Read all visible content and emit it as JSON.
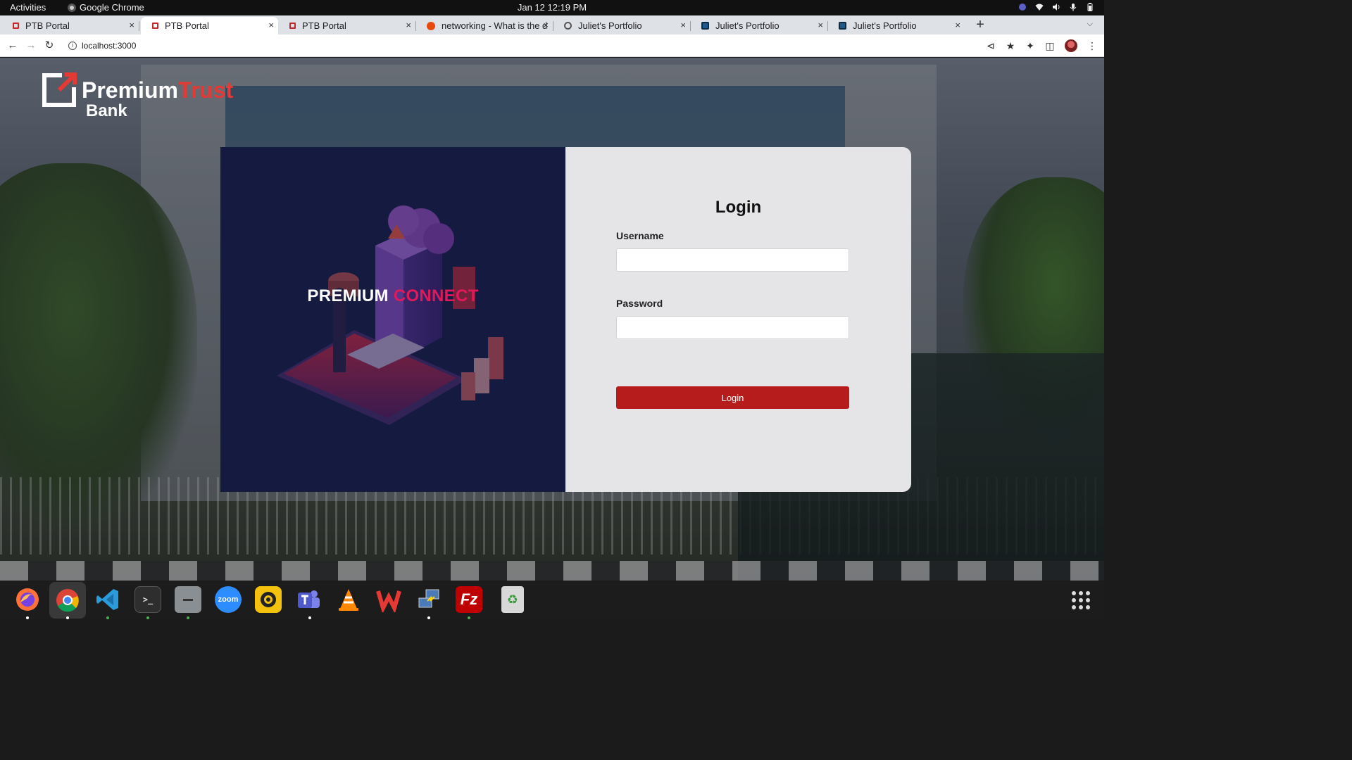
{
  "system_bar": {
    "activities": "Activities",
    "app_name": "Google Chrome",
    "datetime": "Jan 12  12:19 PM"
  },
  "tabs": [
    {
      "title": "PTB Portal",
      "favicon": "ptb-icon",
      "active": false
    },
    {
      "title": "PTB Portal",
      "favicon": "ptb-icon",
      "active": true
    },
    {
      "title": "PTB Portal",
      "favicon": "ptb-icon",
      "active": false
    },
    {
      "title": "networking - What is the d",
      "favicon": "askubuntu-icon",
      "active": false
    },
    {
      "title": "Juliet's Portfolio",
      "favicon": "globe-icon",
      "active": false
    },
    {
      "title": "Juliet's Portfolio",
      "favicon": "portfolio-icon",
      "active": false
    },
    {
      "title": "Juliet's Portfolio",
      "favicon": "portfolio-icon",
      "active": false
    }
  ],
  "tab_close_glyph": "×",
  "new_tab_glyph": "+",
  "address_bar": {
    "url": "localhost:3000"
  },
  "page": {
    "logo": {
      "word1": "Premium",
      "word2": "Trust",
      "word3": "Bank"
    },
    "brand_tag": {
      "white": "PREMIUM",
      "pink": "CONNECT"
    },
    "login": {
      "title": "Login",
      "username_label": "Username",
      "username_value": "",
      "password_label": "Password",
      "password_value": "",
      "submit_label": "Login"
    },
    "colors": {
      "brand_red": "#b71c1c",
      "logo_red": "#e53935",
      "connect_pink": "#e0195a",
      "panel_navy": "#151b40",
      "form_bg": "#e5e5e7"
    }
  },
  "dock": {
    "apps": [
      {
        "name": "firefox-icon",
        "running": true
      },
      {
        "name": "chrome-icon",
        "running": true,
        "focused": true
      },
      {
        "name": "vscode-icon",
        "running": true
      },
      {
        "name": "terminal-icon",
        "running": true
      },
      {
        "name": "files-icon",
        "running": true
      },
      {
        "name": "zoom-icon",
        "label": "zoom",
        "running": false
      },
      {
        "name": "rhythmbox-icon",
        "running": false
      },
      {
        "name": "teams-icon",
        "running": true
      },
      {
        "name": "vlc-icon",
        "running": false
      },
      {
        "name": "wps-office-icon",
        "running": false
      },
      {
        "name": "network-connect-icon",
        "running": true
      },
      {
        "name": "filezilla-icon",
        "running": true
      },
      {
        "name": "trash-icon",
        "running": false
      }
    ]
  }
}
